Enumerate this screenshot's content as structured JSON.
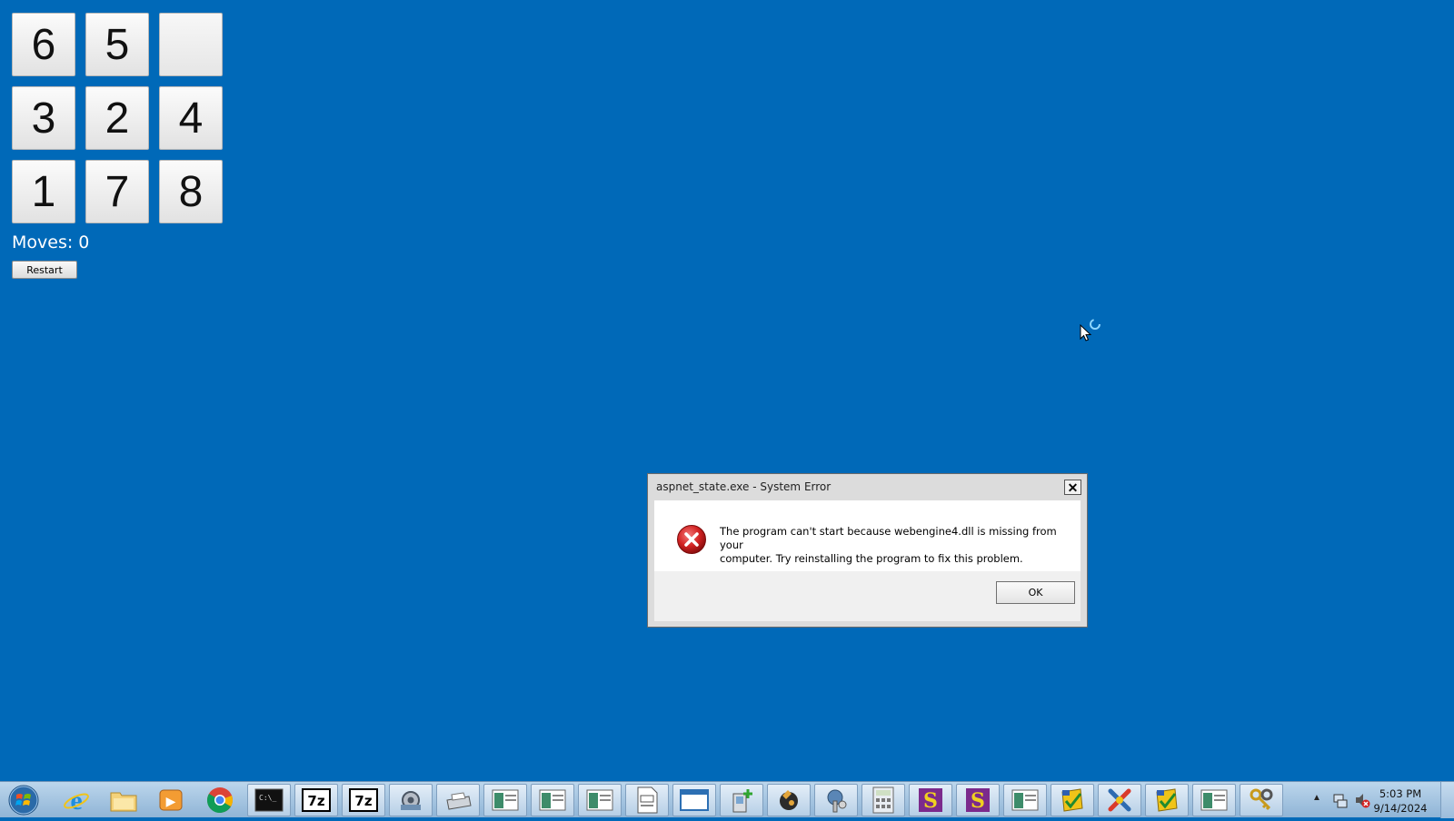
{
  "puzzle": {
    "tiles": [
      "6",
      "5",
      "",
      "3",
      "2",
      "4",
      "1",
      "7",
      "8"
    ],
    "moves_label": "Moves: 0",
    "restart_label": "Restart"
  },
  "dialog": {
    "title": "aspnet_state.exe - System Error",
    "close_label": "✕",
    "message_line1": "The program can't start because webengine4.dll is missing from your",
    "message_line2": "computer. Try reinstalling the program to fix this problem.",
    "ok_label": "OK"
  },
  "taskbar": {
    "items": [
      {
        "icon": "internet-explorer-icon",
        "label": "e"
      },
      {
        "icon": "folder-icon",
        "label": ""
      },
      {
        "icon": "media-player-icon",
        "label": "▶"
      },
      {
        "icon": "chrome-icon",
        "label": ""
      },
      {
        "icon": "command-prompt-icon",
        "label": "C:\\_"
      },
      {
        "icon": "7zip-icon",
        "label": "7z"
      },
      {
        "icon": "7zip-icon",
        "label": "7z"
      },
      {
        "icon": "settings-icon",
        "label": ""
      },
      {
        "icon": "printer-icon",
        "label": ""
      },
      {
        "icon": "app-window-icon",
        "label": ""
      },
      {
        "icon": "app-window-icon",
        "label": ""
      },
      {
        "icon": "app-window-icon",
        "label": ""
      },
      {
        "icon": "document-icon",
        "label": ""
      },
      {
        "icon": "window-icon",
        "label": ""
      },
      {
        "icon": "add-device-icon",
        "label": ""
      },
      {
        "icon": "game-icon",
        "label": ""
      },
      {
        "icon": "tools-icon",
        "label": ""
      },
      {
        "icon": "calculator-icon",
        "label": ""
      },
      {
        "icon": "s-app-icon",
        "label": "S"
      },
      {
        "icon": "s-app-icon",
        "label": "S"
      },
      {
        "icon": "app-window-icon",
        "label": ""
      },
      {
        "icon": "checklist-icon",
        "label": ""
      },
      {
        "icon": "crossed-tools-icon",
        "label": ""
      },
      {
        "icon": "checklist-icon",
        "label": ""
      },
      {
        "icon": "app-window-icon",
        "label": ""
      },
      {
        "icon": "keys-icon",
        "label": ""
      }
    ],
    "clock_time": "5:03 PM",
    "clock_date": "9/14/2024"
  },
  "colors": {
    "desktop": "#0069b8",
    "error_red": "#d22222",
    "taskbar": "#a9c7e2"
  }
}
